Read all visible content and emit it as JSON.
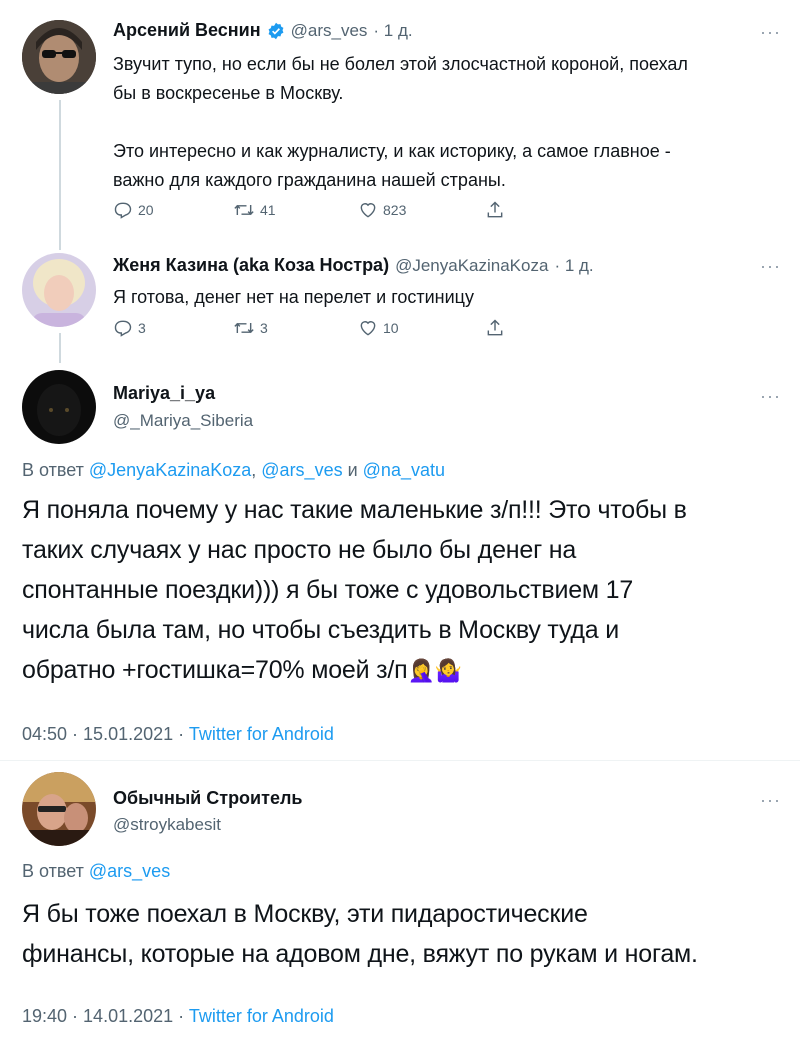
{
  "tweets": [
    {
      "name": "Арсений Веснин",
      "handle": "@ars_ves",
      "time": "· 1 д.",
      "text": [
        "Звучит тупо, но если бы не болел этой злосчастной короной, поехал",
        "бы в воскресенье в Москву.",
        "",
        "Это интересно и как журналисту, и как историку, а самое главное -",
        "важно для каждого гражданина нашей страны."
      ],
      "replies": "20",
      "retweets": "41",
      "likes": "823",
      "verified": true
    },
    {
      "name": "Женя Казина (aka Коза Ностра)",
      "handle": "@JenyaKazinaKoza",
      "time": "· 1 д.",
      "text": [
        "Я готова, денег нет на перелет и гостиницу"
      ],
      "replies": "3",
      "retweets": "3",
      "likes": "10"
    }
  ],
  "main_tweet": {
    "name": "Mariya_i_ya",
    "handle": "@_Mariya_Siberia",
    "reply_prefix": "В ответ ",
    "reply_to": [
      "@JenyaKazinaKoza",
      "@ars_ves",
      "@na_vatu"
    ],
    "reply_sep1": ", ",
    "reply_sep2": " и ",
    "text": [
      "Я поняла почему у нас такие маленькие з/п!!! Это чтобы в",
      "таких случаях у нас просто не было бы денег на",
      "спонтанные поездки))) я бы тоже с удовольствием 17",
      "числа была там, но чтобы съездить в Москву туда и",
      "обратно +гостишка=70% моей з/п"
    ],
    "emoji": [
      "🤦‍♀️",
      "🤷‍♀️"
    ],
    "time": "04:50",
    "date": "15.01.2021",
    "source": "Twitter for Android"
  },
  "second_tweet": {
    "name": "Обычный Строитель",
    "handle": "@stroykabesit",
    "reply_prefix": "В ответ ",
    "reply_to": "@ars_ves",
    "text": [
      "Я бы тоже поехал в Москву, эти пидаростические",
      "финансы, которые на адовом дне, вяжут по рукам и ногам."
    ],
    "time": "19:40",
    "date": "14.01.2021",
    "source": "Twitter for Android"
  },
  "ui": {
    "more": "···",
    "meta_sep": " · ",
    "accent": "#1d9bf0",
    "icons": [
      "reply-icon",
      "retweet-icon",
      "like-icon",
      "share-icon",
      "verified-badge-icon",
      "more-icon"
    ]
  }
}
